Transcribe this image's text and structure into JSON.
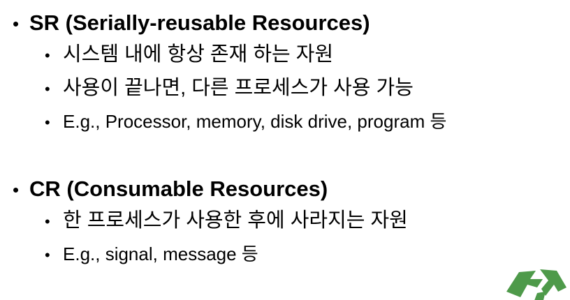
{
  "sr": {
    "heading": "SR (Serially-reusable Resources)",
    "items": [
      "시스템 내에 항상 존재 하는 자원",
      "사용이 끝나면, 다른 프로세스가 사용 가능",
      "E.g., Processor, memory, disk drive, program 등"
    ]
  },
  "cr": {
    "heading": "CR (Consumable Resources)",
    "items": [
      "한 프로세스가 사용한 후에 사라지는 자원",
      "E.g., signal, message 등"
    ]
  },
  "bullet_char": "•",
  "logo": {
    "icon": "recycle-arrows-icon",
    "color": "#4e9a4a"
  }
}
